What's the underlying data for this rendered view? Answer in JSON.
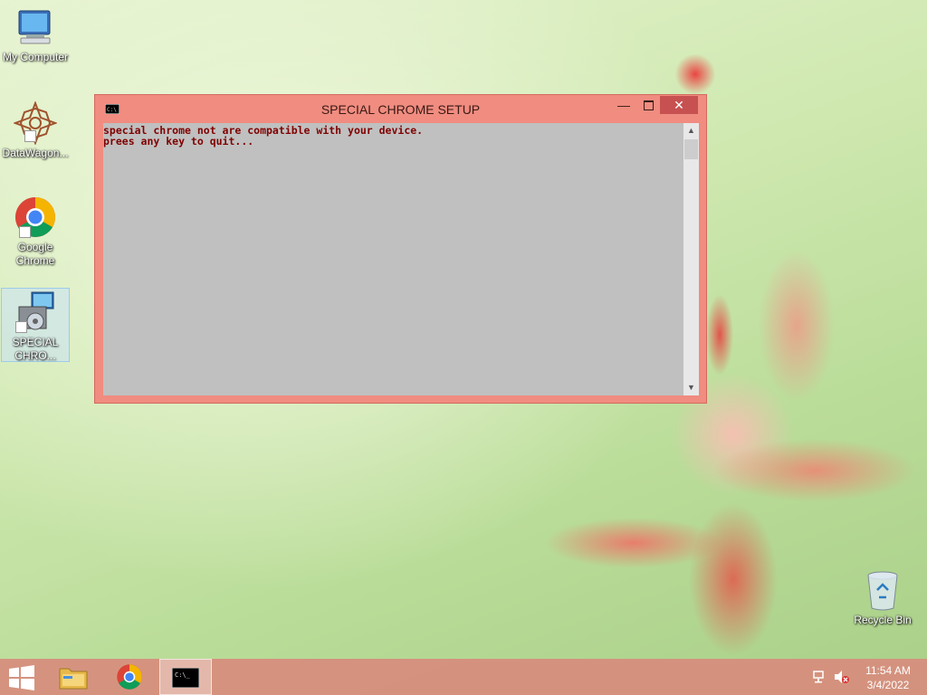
{
  "desktop": {
    "icons": [
      {
        "label": "My Computer"
      },
      {
        "label": "DataWagon..."
      },
      {
        "label": "Google Chrome"
      },
      {
        "label": "SPECIAL CHRO..."
      },
      {
        "label": "Recycle Bin"
      }
    ]
  },
  "window": {
    "title": "SPECIAL CHROME SETUP",
    "console_lines": [
      "special chrome not are compatible with your device.",
      "prees any key to quit..."
    ],
    "app_icon_text": "C:\\"
  },
  "taskbar": {
    "clock_time": "11:54 AM",
    "clock_date": "3/4/2022",
    "console_icon_text": "C:\\_"
  },
  "colors": {
    "window_frame": "#f08c80",
    "console_bg": "#c0c0c0",
    "console_text": "#800000",
    "taskbar": "#d78c7d"
  }
}
